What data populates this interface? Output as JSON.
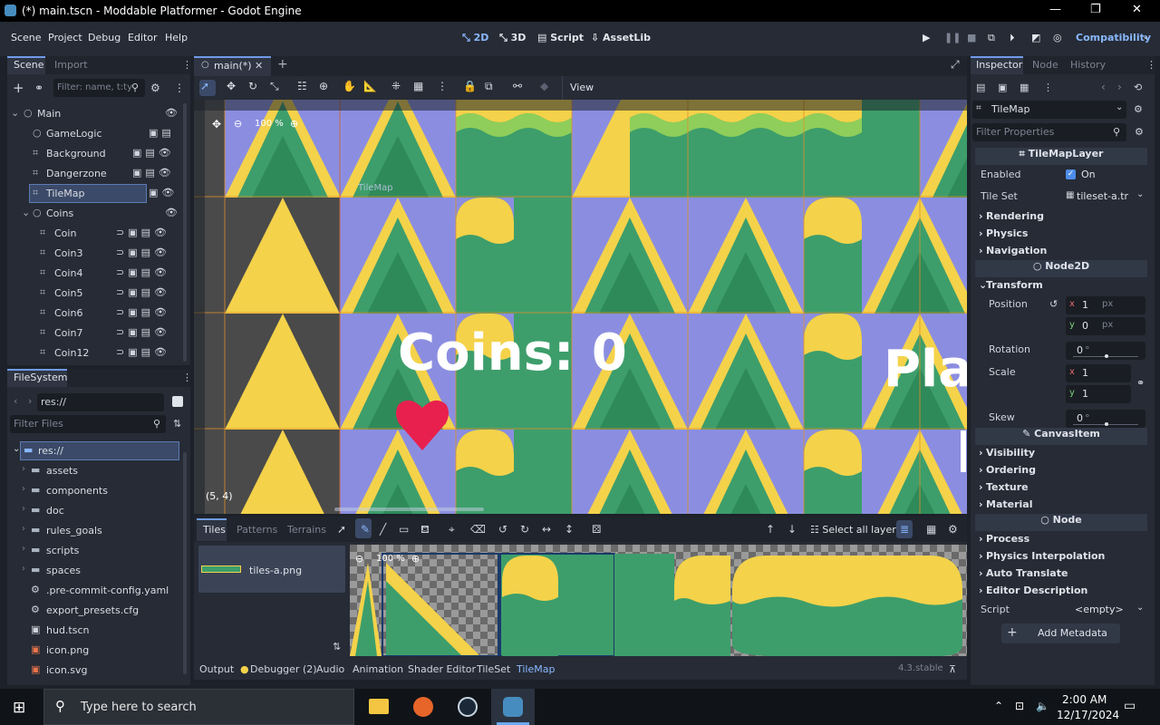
{
  "window": {
    "title": "(*) main.tscn - Moddable Platformer - Godot Engine"
  },
  "menu": [
    "Scene",
    "Project",
    "Debug",
    "Editor",
    "Help"
  ],
  "modes": {
    "m2d": "2D",
    "m3d": "3D",
    "script": "Script",
    "assetlib": "AssetLib"
  },
  "renderer": "Compatibility",
  "left_top": {
    "tabs": [
      "Scene",
      "Import"
    ],
    "filter_placeholder": "Filter: name, t:ty",
    "tree": [
      "Main",
      "GameLogic",
      "Background",
      "Dangerzone",
      "TileMap",
      "Coins",
      "Coin",
      "Coin3",
      "Coin4",
      "Coin5",
      "Coin6",
      "Coin7",
      "Coin12"
    ]
  },
  "filesystem": {
    "tab": "FileSystem",
    "path": "res://",
    "filter_placeholder": "Filter Files",
    "items": [
      "res://",
      "assets",
      "components",
      "doc",
      "rules_goals",
      "scripts",
      "spaces",
      ".pre-commit-config.yaml",
      "export_presets.cfg",
      "hud.tscn",
      "icon.png",
      "icon.svg"
    ]
  },
  "editor": {
    "tab": "main(*)",
    "view_label": "View",
    "zoom": "100 %",
    "node_label": "TileMap",
    "coins_text": "Coins: 0",
    "play_text": "Pla",
    "coords": "(5, 4)"
  },
  "tilemap_panel": {
    "tabs": [
      "Tiles",
      "Patterns",
      "Terrains"
    ],
    "select_all_layers": "Select all layers",
    "source": "tiles-a.png",
    "zoom": "100 %"
  },
  "bottom_tabs": [
    "Output",
    "Debugger (2)",
    "Audio",
    "Animation",
    "Shader Editor",
    "TileSet",
    "TileMap"
  ],
  "version": "4.3.stable",
  "inspector": {
    "tabs": [
      "Inspector",
      "Node",
      "History"
    ],
    "node": "TileMap",
    "filter_placeholder": "Filter Properties",
    "class": "TileMapLayer",
    "enabled_label": "Enabled",
    "enabled_value": "On",
    "tileset_label": "Tile Set",
    "tileset_value": "tileset-a.tr",
    "sections1": [
      "Rendering",
      "Physics",
      "Navigation"
    ],
    "node2d": "Node2D",
    "transform": "Transform",
    "position_label": "Position",
    "pos_x": "1",
    "pos_y": "0",
    "unit_px": "px",
    "rotation_label": "Rotation",
    "rotation_value": "0",
    "scale_label": "Scale",
    "scale_x": "1",
    "scale_y": "1",
    "skew_label": "Skew",
    "skew_value": "0",
    "deg": "°",
    "canvasitem": "CanvasItem",
    "sections2": [
      "Visibility",
      "Ordering",
      "Texture",
      "Material"
    ],
    "node_hdr": "Node",
    "sections3": [
      "Process",
      "Physics Interpolation",
      "Auto Translate",
      "Editor Description"
    ],
    "script_label": "Script",
    "script_value": "<empty>",
    "add_metadata": "Add Metadata"
  },
  "taskbar": {
    "search": "Type here to search",
    "time": "2:00 AM",
    "date": "12/17/2024"
  },
  "colors": {
    "accent": "#6f9ae8",
    "tile_purple": "#8b8ee0",
    "tile_green": "#3d9e6b",
    "tile_yellow": "#f4d24a",
    "heart": "#e8204e"
  }
}
